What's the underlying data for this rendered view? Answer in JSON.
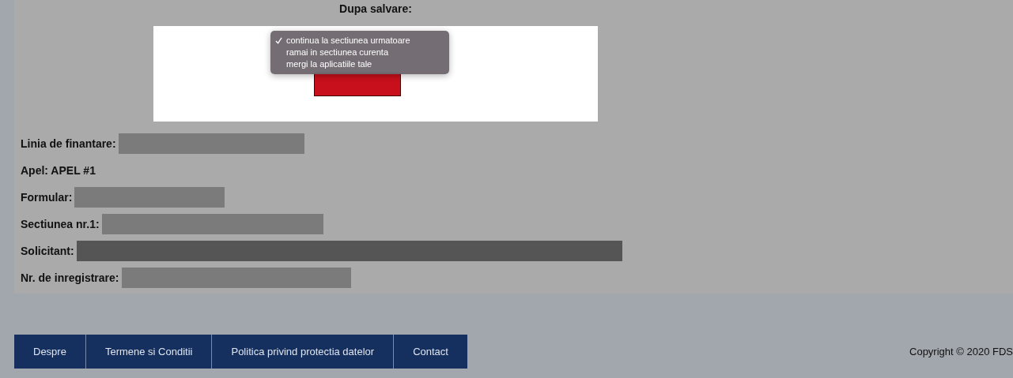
{
  "save_panel": {
    "title": "Dupa salvare:",
    "menu": [
      {
        "label": "continua la sectiunea urmatoare",
        "selected": true
      },
      {
        "label": "ramai in sectiunea curenta",
        "selected": false
      },
      {
        "label": "mergi la aplicatiile tale",
        "selected": false
      }
    ]
  },
  "fields": [
    {
      "label": "Linia de finantare:",
      "redacted": true
    },
    {
      "label": "Apel: APEL #1",
      "redacted": false
    },
    {
      "label": "Formular:",
      "redacted": true
    },
    {
      "label": "Sectiunea nr.1:",
      "redacted": true
    },
    {
      "label": "Solicitant:",
      "redacted": true
    },
    {
      "label": "Nr. de inregistrare:",
      "redacted": true
    }
  ],
  "footer": {
    "links": [
      "Despre",
      "Termene si Conditii",
      "Politica privind protectia datelor",
      "Contact"
    ],
    "copyright": "Copyright © 2020 FDS"
  }
}
